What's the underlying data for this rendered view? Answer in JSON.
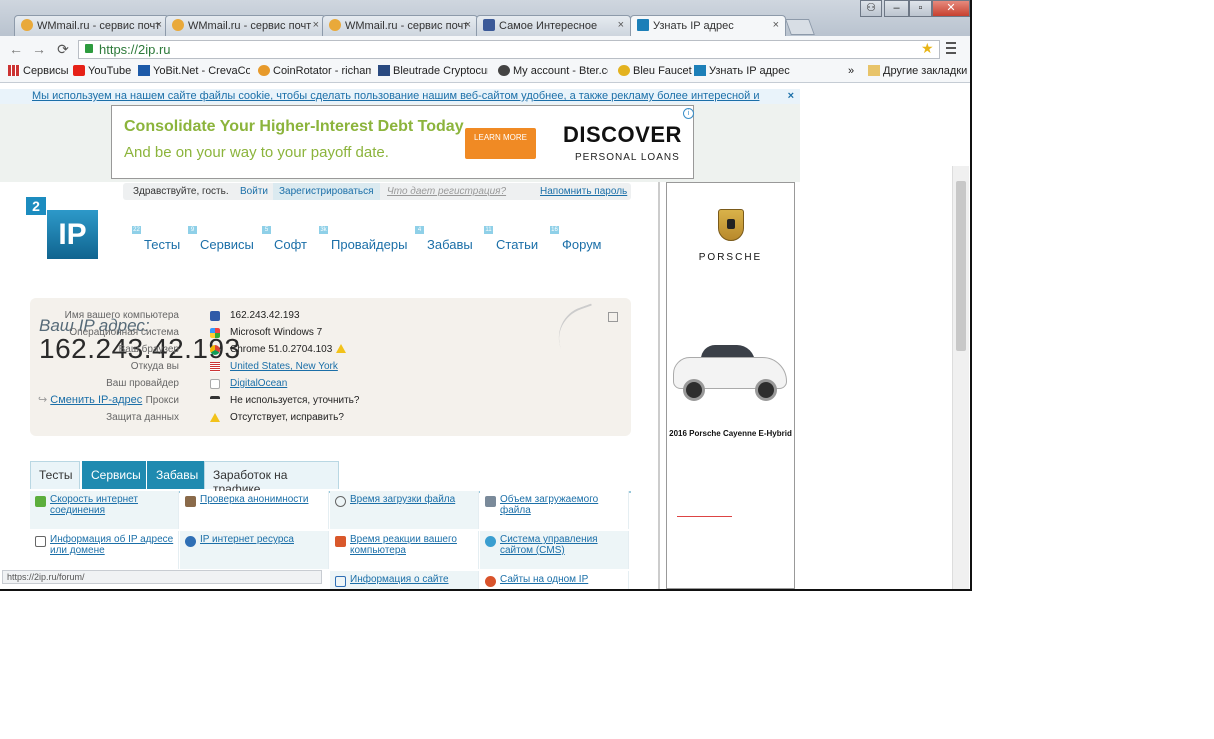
{
  "tabs": [
    {
      "title": "WMmail.ru - сервис почт",
      "icon": "wmmail-icon",
      "active": false
    },
    {
      "title": "WMmail.ru - сервис почт",
      "icon": "wmmail-icon",
      "active": false
    },
    {
      "title": "WMmail.ru - сервис почт",
      "icon": "wmmail-icon",
      "active": false
    },
    {
      "title": "Самое Интересное",
      "icon": "facebook-icon",
      "active": false
    },
    {
      "title": "Узнать IP адрес",
      "icon": "2ip-icon",
      "active": true
    }
  ],
  "tab_close": "×",
  "address": {
    "url": "https://2ip.ru"
  },
  "bookmarks": [
    {
      "label": "Сервисы",
      "icon": "apps-icon"
    },
    {
      "label": "YouTube",
      "icon": "youtube-icon"
    },
    {
      "label": "YoBit.Net - CrevaCoin",
      "icon": "yobit-icon"
    },
    {
      "label": "CoinRotator - richamy",
      "icon": "coinrotator-icon"
    },
    {
      "label": "Bleutrade Cryptocurre",
      "icon": "bleutrade-icon"
    },
    {
      "label": "My account - Bter.com",
      "icon": "bter-icon"
    },
    {
      "label": "Bleu Faucet",
      "icon": "bleufaucet-icon"
    },
    {
      "label": "Узнать IP адрес",
      "icon": "2ip-icon"
    }
  ],
  "bookmarks_more": "»",
  "other_bookmarks": "Другие закладки",
  "cookie_notice": "Мы используем на нашем сайте файлы cookie, чтобы сделать пользование нашим веб-сайтом удобнее, а также рекламу более интересной и подходящей для вас.",
  "cookie_close": "×",
  "ad": {
    "headline": "Consolidate Your Higher-Interest Debt Today",
    "subline": "And be on your way to your payoff date.",
    "button": "LEARN MORE",
    "brand": "DISCOVER",
    "brand_sub": "PERSONAL LOANS",
    "info": "i",
    "colors": {
      "green": "#8cb43c",
      "orange": "#f08a24"
    }
  },
  "login": {
    "greeting": "Здравствуйте, гость.",
    "login": "Войти",
    "register": "Зарегистрироваться",
    "why": "Что дает регистрация?",
    "remind": "Напомнить пароль"
  },
  "logo": {
    "small": "2",
    "big": "IP"
  },
  "nav": [
    {
      "label": "Тесты",
      "count": "22"
    },
    {
      "label": "Сервисы",
      "count": "9"
    },
    {
      "label": "Софт",
      "count": "5"
    },
    {
      "label": "Провайдеры",
      "count": "3k"
    },
    {
      "label": "Забавы",
      "count": "4"
    },
    {
      "label": "Статьи",
      "count": "11"
    },
    {
      "label": "Форум",
      "count": "16"
    }
  ],
  "ipinfo": {
    "label": "Ваш IP адрес:",
    "ip": "162.243.42.193",
    "change": "Сменить IP-адрес",
    "rows": [
      {
        "key": "Имя вашего компьютера",
        "value": "162.243.42.193",
        "icon": "computer-icon",
        "link": false
      },
      {
        "key": "Операционная система",
        "value": "Microsoft Windows 7",
        "icon": "windows-icon",
        "link": false
      },
      {
        "key": "Ваш браузер",
        "value": "Chrome 51.0.2704.103",
        "icon": "chrome-icon",
        "link": false,
        "warn": true
      },
      {
        "key": "Откуда вы",
        "value": "United States, New York",
        "icon": "us-flag-icon",
        "link": true
      },
      {
        "key": "Ваш провайдер",
        "value": "DigitalOcean",
        "icon": "provider-icon",
        "link": true
      },
      {
        "key": "Прокси",
        "value": "Не используется, уточнить?",
        "icon": "glasses-icon",
        "link": false
      },
      {
        "key": "Защита данных",
        "value": "Отсутствует, исправить?",
        "icon": "warning-icon",
        "link": false
      }
    ]
  },
  "service_tabs": [
    {
      "label": "Тесты",
      "active": false
    },
    {
      "label": "Сервисы",
      "active": true
    },
    {
      "label": "Забавы",
      "active": true
    },
    {
      "label": "Заработок на трафике",
      "active": false
    }
  ],
  "services": [
    {
      "label": "Скорость интернет соединения",
      "icon": "speed-icon"
    },
    {
      "label": "Проверка анонимности",
      "icon": "anonymity-icon"
    },
    {
      "label": "Время загрузки файла",
      "icon": "clock-icon"
    },
    {
      "label": "Объем загружаемого файла",
      "icon": "file-size-icon"
    },
    {
      "label": "Информация об IP адресе или домене",
      "icon": "info-icon"
    },
    {
      "label": "IP интернет ресурса",
      "icon": "globe-icon"
    },
    {
      "label": "Время реакции вашего компьютера",
      "icon": "reaction-icon"
    },
    {
      "label": "Система управления сайтом (CMS)",
      "icon": "cms-icon"
    },
    {
      "label": "Информация о сайте",
      "icon": "site-info-icon"
    },
    {
      "label": "Сайты на одном IP",
      "icon": "sites-ip-icon"
    }
  ],
  "side_ad": {
    "brand": "PORSCHE",
    "model": "2016 Porsche Cayenne E-Hybrid"
  },
  "status_url": "https://2ip.ru/forum/"
}
